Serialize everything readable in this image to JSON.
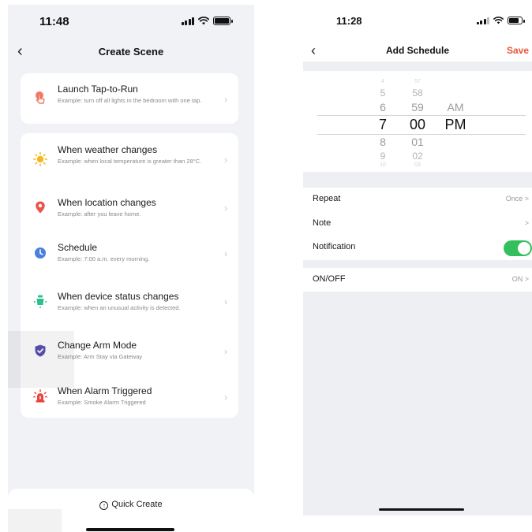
{
  "left": {
    "status": {
      "time": "11:48"
    },
    "nav": {
      "back": "‹",
      "title": "Create Scene"
    },
    "tap_to_run": {
      "title": "Launch Tap-to-Run",
      "desc": "Example: turn off all lights in the bedroom with one tap."
    },
    "conditions": [
      {
        "title": "When weather changes",
        "desc": "Example: when local temperature is greater than 28°C.",
        "icon": "sun-icon"
      },
      {
        "title": "When location changes",
        "desc": "Example: after you leave home.",
        "icon": "location-pin-icon"
      },
      {
        "title": "Schedule",
        "desc": "Example: 7:00 a.m. every morning.",
        "icon": "clock-icon"
      },
      {
        "title": "When device status changes",
        "desc": "Example: when an unusual activity is detected.",
        "icon": "device-icon"
      },
      {
        "title": "Change Arm Mode",
        "desc": "Example: Arm Stay via Gateway",
        "icon": "shield-icon"
      },
      {
        "title": "When Alarm Triggered",
        "desc": "Example: Smoke Alarm Triggered",
        "icon": "alarm-siren-icon"
      }
    ],
    "quick_create": "Quick Create",
    "colors": {
      "tap": "#f0654a",
      "sun": "#f7b51e",
      "location": "#e9554a",
      "clock": "#4a7fdc",
      "device": "#2bbf8f",
      "shield": "#5a52b5",
      "alarm": "#e8453c"
    }
  },
  "right": {
    "status": {
      "time": "11:28"
    },
    "nav": {
      "back": "‹",
      "title": "Add Schedule",
      "save": "Save"
    },
    "picker": {
      "hours": [
        "4",
        "5",
        "6",
        "7",
        "8",
        "9",
        "10"
      ],
      "minutes": [
        "57",
        "58",
        "59",
        "00",
        "01",
        "02",
        "03"
      ],
      "ampm": [
        "AM",
        "PM"
      ]
    },
    "rows": {
      "repeat": {
        "label": "Repeat",
        "value": "Once >"
      },
      "note": {
        "label": "Note",
        "value": ">"
      },
      "notification": {
        "label": "Notification"
      },
      "onoff": {
        "label": "ON/OFF",
        "value": "ON >"
      }
    },
    "colors": {
      "save": "#e8553a",
      "toggle": "#33c05c"
    }
  }
}
